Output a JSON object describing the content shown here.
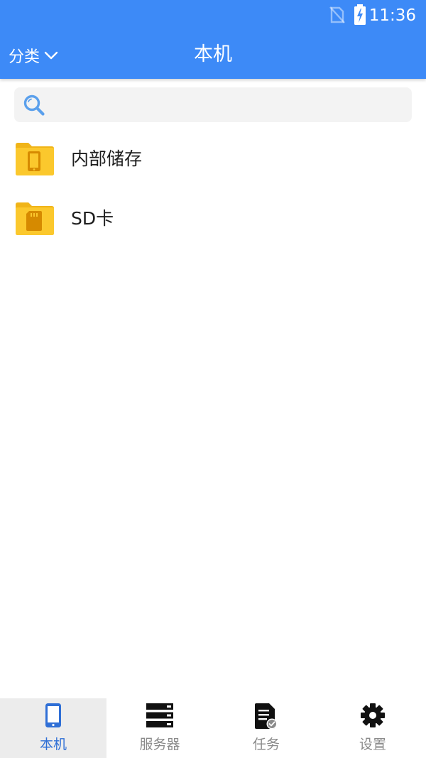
{
  "status_bar": {
    "time": "11:36",
    "icons": [
      "no-sim-icon",
      "battery-charging-icon"
    ]
  },
  "toolbar": {
    "category_label": "分类",
    "title": "本机"
  },
  "search": {
    "placeholder": "",
    "value": ""
  },
  "storage_items": [
    {
      "label": "内部储存",
      "icon": "phone-folder-icon"
    },
    {
      "label": "SD卡",
      "icon": "sd-card-folder-icon"
    }
  ],
  "bottom_nav": {
    "tabs": [
      {
        "label": "本机",
        "icon": "phone-icon",
        "active": true
      },
      {
        "label": "服务器",
        "icon": "server-icon",
        "active": false
      },
      {
        "label": "任务",
        "icon": "task-document-icon",
        "active": false
      },
      {
        "label": "设置",
        "icon": "gear-icon",
        "active": false
      }
    ]
  },
  "colors": {
    "header": "#3d8af7",
    "active_tab": "#2f6fd6",
    "folder": "#fbc82d",
    "folder_dark": "#d68a00"
  }
}
